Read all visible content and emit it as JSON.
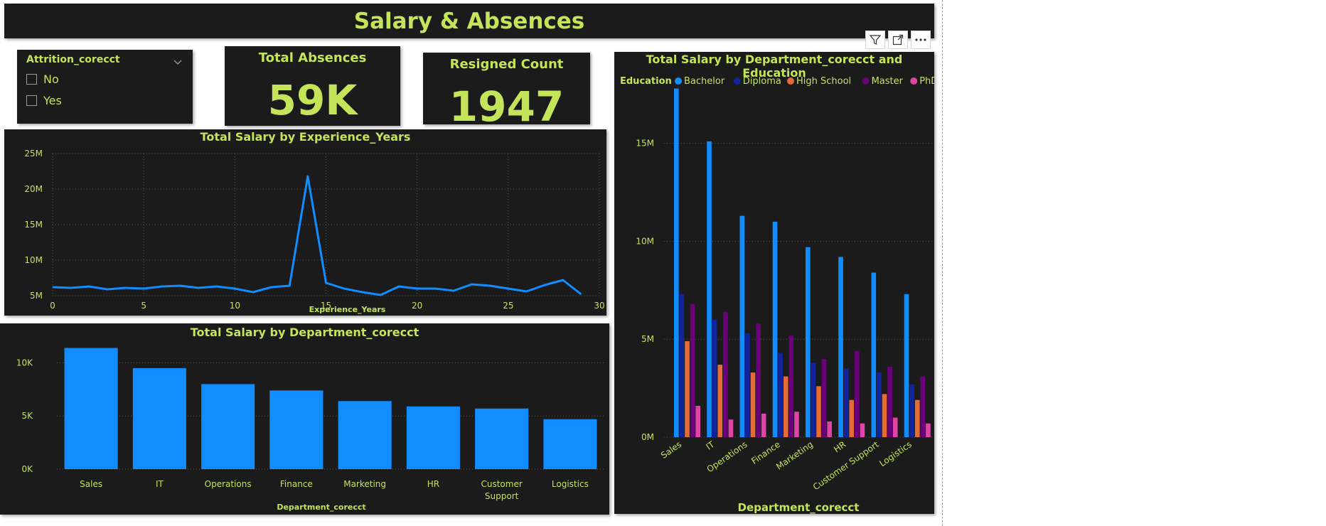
{
  "header": {
    "title": "Salary & Absences"
  },
  "slicer": {
    "title": "Attrition_corecct",
    "options": [
      "No",
      "Yes"
    ]
  },
  "cards": [
    {
      "label": "Total Absences",
      "value": "59K"
    },
    {
      "label": "Resigned Count",
      "value": "1947"
    }
  ],
  "colors": {
    "accent": "#c4e45a",
    "panel": "#1b1b1b",
    "bar": "#118dff"
  },
  "visual_header_icons": [
    "filter-icon",
    "focus-mode-icon",
    "more-options-icon"
  ],
  "chart_data": [
    {
      "type": "line",
      "title": "Total Salary by Experience_Years",
      "xlabel": "Experience_Years",
      "ylabel": "",
      "xlim": [
        0,
        30
      ],
      "ylim": [
        5000000,
        25000000
      ],
      "x_ticks": [
        0,
        5,
        10,
        15,
        20,
        25,
        30
      ],
      "x_tick_labels": [
        "0",
        "5",
        "10",
        "15",
        "20",
        "25",
        "30"
      ],
      "y_ticks": [
        5000000,
        10000000,
        15000000,
        20000000,
        25000000
      ],
      "y_tick_labels": [
        "5M",
        "10M",
        "15M",
        "20M",
        "25M"
      ],
      "grid": true,
      "series": [
        {
          "color": "#118dff",
          "x": [
            0,
            1,
            2,
            3,
            4,
            5,
            6,
            7,
            8,
            9,
            10,
            11,
            12,
            13,
            14,
            15,
            16,
            17,
            18,
            19,
            20,
            21,
            22,
            23,
            24,
            25,
            26,
            27,
            28,
            29
          ],
          "y": [
            6200000,
            6100000,
            6300000,
            5900000,
            6100000,
            6000000,
            6300000,
            6400000,
            6100000,
            6300000,
            6000000,
            5500000,
            6200000,
            6400000,
            21800000,
            6800000,
            6000000,
            5500000,
            5100000,
            6300000,
            6000000,
            6000000,
            5700000,
            6600000,
            6400000,
            6000000,
            5600000,
            6500000,
            7200000,
            5200000
          ]
        }
      ]
    },
    {
      "type": "bar",
      "title": "Total Salary by Department_corecct",
      "xlabel": "Department_corecct",
      "ylabel": "",
      "ylim": [
        0,
        11500
      ],
      "y_ticks": [
        0,
        5000,
        10000
      ],
      "y_tick_labels": [
        "0K",
        "5K",
        "10K"
      ],
      "grid": true,
      "categories": [
        "Sales",
        "IT",
        "Operations",
        "Finance",
        "Marketing",
        "HR",
        "Customer Support",
        "Logistics"
      ],
      "values": [
        11400,
        9500,
        8000,
        7400,
        6400,
        5900,
        5700,
        4700
      ]
    },
    {
      "type": "bar",
      "title": "Total Salary by Department_corecct and Education",
      "xlabel": "Department_corecct",
      "ylabel": "",
      "ylim": [
        0,
        18000000
      ],
      "y_ticks": [
        0,
        5000000,
        10000000,
        15000000
      ],
      "y_tick_labels": [
        "0M",
        "5M",
        "10M",
        "15M"
      ],
      "grid": true,
      "legend": {
        "title": "Education",
        "position": "top-left"
      },
      "categories": [
        "Sales",
        "IT",
        "Operations",
        "Finance",
        "Marketing",
        "HR",
        "Customer Support",
        "Logistics"
      ],
      "series": [
        {
          "name": "Bachelor",
          "color": "#118dff",
          "values": [
            17800000,
            15100000,
            11300000,
            11000000,
            9700000,
            9200000,
            8400000,
            7300000
          ]
        },
        {
          "name": "Diploma",
          "color": "#12239e",
          "values": [
            7300000,
            6000000,
            5300000,
            4300000,
            3800000,
            3500000,
            3300000,
            2700000
          ]
        },
        {
          "name": "High School",
          "color": "#e66c37",
          "values": [
            4900000,
            3700000,
            3300000,
            3100000,
            2600000,
            1900000,
            2200000,
            1900000
          ]
        },
        {
          "name": "Master",
          "color": "#6b007b",
          "values": [
            6800000,
            6400000,
            5800000,
            5200000,
            4000000,
            4400000,
            3600000,
            3100000
          ]
        },
        {
          "name": "PhD",
          "color": "#e044a7",
          "values": [
            1600000,
            900000,
            1200000,
            1300000,
            800000,
            700000,
            1000000,
            700000
          ]
        }
      ]
    }
  ]
}
